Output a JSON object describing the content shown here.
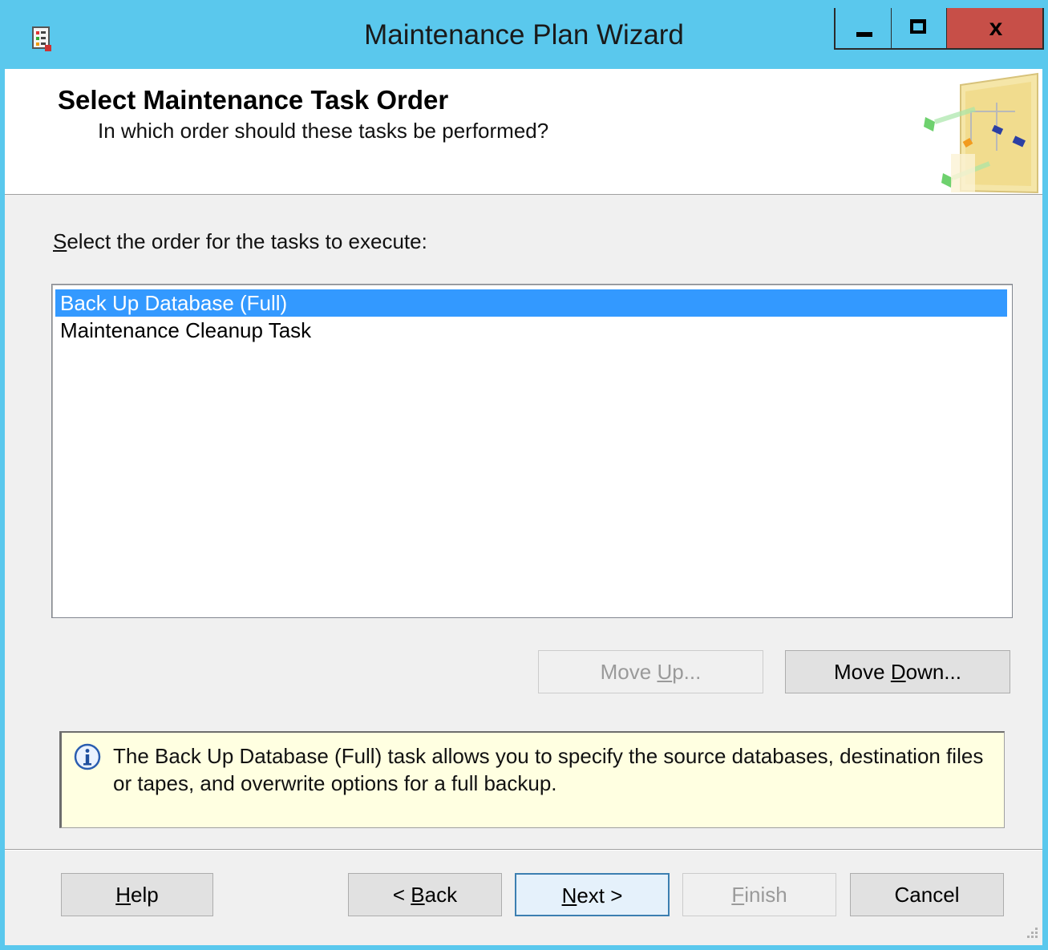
{
  "window": {
    "title": "Maintenance Plan Wizard",
    "close_glyph": "x",
    "icons": {
      "app": "maintenance-plan-icon",
      "minimize": "minimize-icon",
      "maximize": "maximize-icon",
      "close": "close-icon"
    }
  },
  "header": {
    "title": "Select Maintenance Task Order",
    "subtitle": "In which order should these tasks be performed?",
    "art_icon": "wizard-banner-icon"
  },
  "task_list": {
    "label_prefix": "",
    "label_mnemonic": "S",
    "label_rest": "elect the order for the tasks to execute:",
    "items": [
      {
        "label": "Back Up Database (Full)",
        "selected": true
      },
      {
        "label": "Maintenance Cleanup Task",
        "selected": false
      }
    ]
  },
  "buttons": {
    "move_up": {
      "pre": "Move ",
      "mnemonic": "U",
      "post": "p...",
      "enabled": false
    },
    "move_down": {
      "pre": "Move ",
      "mnemonic": "D",
      "post": "own...",
      "enabled": true
    },
    "help": {
      "pre": "",
      "mnemonic": "H",
      "post": "elp",
      "enabled": true
    },
    "back": {
      "pre": "< ",
      "mnemonic": "B",
      "post": "ack",
      "enabled": true
    },
    "next": {
      "pre": "",
      "mnemonic": "N",
      "post": "ext >",
      "enabled": true
    },
    "finish": {
      "pre": "",
      "mnemonic": "F",
      "post": "inish",
      "enabled": false
    },
    "cancel": {
      "label": "Cancel",
      "enabled": true
    }
  },
  "info": {
    "icon": "info-icon",
    "text": "The Back Up Database (Full) task allows you to specify the source databases, destination files or tapes, and overwrite options for a full backup."
  },
  "colors": {
    "title_bar": "#5ac8ed",
    "close_button": "#c74f48",
    "selection": "#3399ff",
    "info_background": "#ffffe1"
  }
}
